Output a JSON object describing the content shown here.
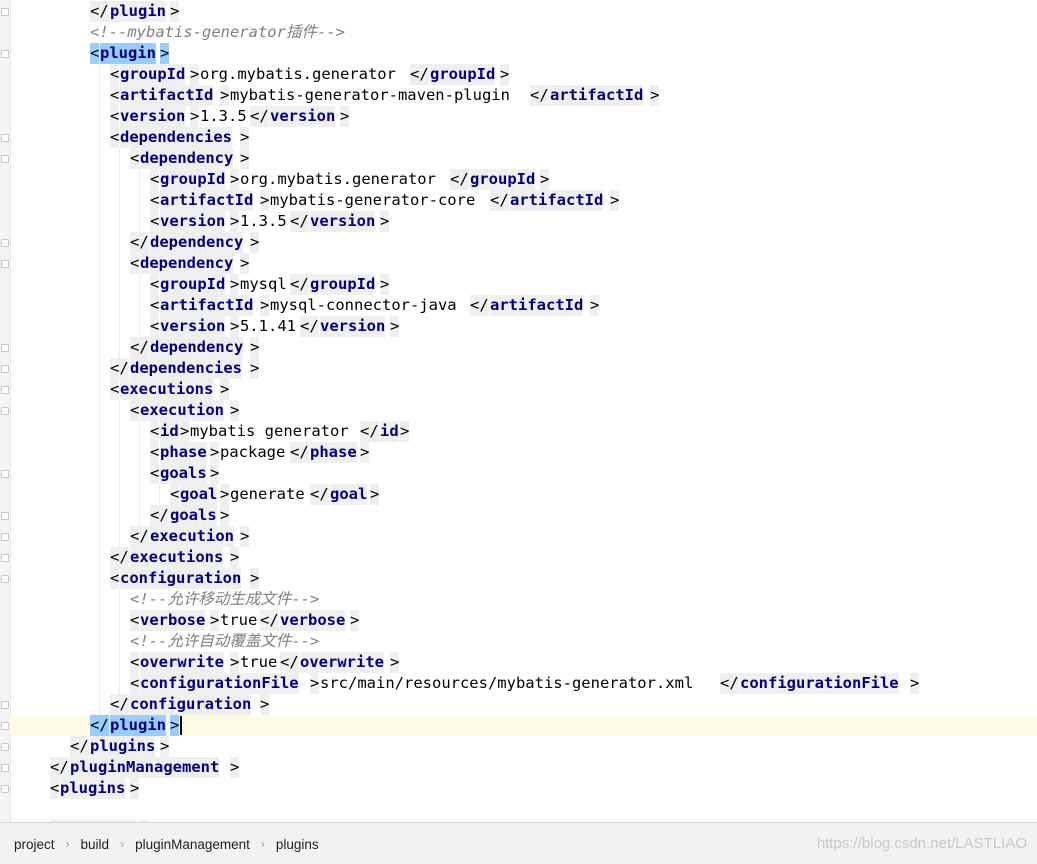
{
  "editor": {
    "lines": [
      {
        "t": [
          [
            "c",
            "</"
          ],
          [
            "n",
            "plugin"
          ],
          [
            "c",
            ">"
          ]
        ]
      },
      {
        "t": [
          [
            "m",
            "<!--mybatis-generator插件-->"
          ]
        ]
      },
      {
        "t": [
          [
            "o",
            "<"
          ],
          [
            "on",
            "plugin"
          ],
          [
            "o",
            ">"
          ]
        ]
      },
      {
        "t": [
          [
            "c",
            "<"
          ],
          [
            "n",
            "groupId"
          ],
          [
            "c",
            ">"
          ],
          [
            "x",
            "org.mybatis.generator"
          ],
          [
            "c",
            "</"
          ],
          [
            "n",
            "groupId"
          ],
          [
            "c",
            ">"
          ]
        ]
      },
      {
        "t": [
          [
            "c",
            "<"
          ],
          [
            "n",
            "artifactId"
          ],
          [
            "c",
            ">"
          ],
          [
            "x",
            "mybatis-generator-maven-plugin"
          ],
          [
            "c",
            "</"
          ],
          [
            "n",
            "artifactId"
          ],
          [
            "c",
            ">"
          ]
        ]
      },
      {
        "t": [
          [
            "c",
            "<"
          ],
          [
            "n",
            "version"
          ],
          [
            "c",
            ">"
          ],
          [
            "x",
            "1.3.5"
          ],
          [
            "c",
            "</"
          ],
          [
            "n",
            "version"
          ],
          [
            "c",
            ">"
          ]
        ]
      },
      {
        "t": [
          [
            "c",
            "<"
          ],
          [
            "n",
            "dependencies"
          ],
          [
            "c",
            ">"
          ]
        ]
      },
      {
        "t": [
          [
            "c",
            "<"
          ],
          [
            "n",
            "dependency"
          ],
          [
            "c",
            ">"
          ]
        ]
      },
      {
        "t": [
          [
            "c",
            "<"
          ],
          [
            "n",
            "groupId"
          ],
          [
            "c",
            ">"
          ],
          [
            "x",
            "org.mybatis.generator"
          ],
          [
            "c",
            "</"
          ],
          [
            "n",
            "groupId"
          ],
          [
            "c",
            ">"
          ]
        ]
      },
      {
        "t": [
          [
            "c",
            "<"
          ],
          [
            "n",
            "artifactId"
          ],
          [
            "c",
            ">"
          ],
          [
            "x",
            "mybatis-generator-core"
          ],
          [
            "c",
            "</"
          ],
          [
            "n",
            "artifactId"
          ],
          [
            "c",
            ">"
          ]
        ]
      },
      {
        "t": [
          [
            "c",
            "<"
          ],
          [
            "n",
            "version"
          ],
          [
            "c",
            ">"
          ],
          [
            "x",
            "1.3.5"
          ],
          [
            "c",
            "</"
          ],
          [
            "n",
            "version"
          ],
          [
            "c",
            ">"
          ]
        ]
      },
      {
        "t": [
          [
            "c",
            "</"
          ],
          [
            "n",
            "dependency"
          ],
          [
            "c",
            ">"
          ]
        ]
      },
      {
        "t": [
          [
            "c",
            "<"
          ],
          [
            "n",
            "dependency"
          ],
          [
            "c",
            ">"
          ]
        ]
      },
      {
        "t": [
          [
            "c",
            "<"
          ],
          [
            "n",
            "groupId"
          ],
          [
            "c",
            ">"
          ],
          [
            "x",
            "mysql"
          ],
          [
            "c",
            "</"
          ],
          [
            "n",
            "groupId"
          ],
          [
            "c",
            ">"
          ]
        ]
      },
      {
        "t": [
          [
            "c",
            "<"
          ],
          [
            "n",
            "artifactId"
          ],
          [
            "c",
            ">"
          ],
          [
            "x",
            "mysql-connector-java"
          ],
          [
            "c",
            "</"
          ],
          [
            "n",
            "artifactId"
          ],
          [
            "c",
            ">"
          ]
        ]
      },
      {
        "t": [
          [
            "c",
            "<"
          ],
          [
            "n",
            "version"
          ],
          [
            "c",
            ">"
          ],
          [
            "x",
            "5.1.41"
          ],
          [
            "c",
            "</"
          ],
          [
            "n",
            "version"
          ],
          [
            "c",
            ">"
          ]
        ]
      },
      {
        "t": [
          [
            "c",
            "</"
          ],
          [
            "n",
            "dependency"
          ],
          [
            "c",
            ">"
          ]
        ]
      },
      {
        "t": [
          [
            "c",
            "</"
          ],
          [
            "n",
            "dependencies"
          ],
          [
            "c",
            ">"
          ]
        ]
      },
      {
        "t": [
          [
            "c",
            "<"
          ],
          [
            "n",
            "executions"
          ],
          [
            "c",
            ">"
          ]
        ]
      },
      {
        "t": [
          [
            "c",
            "<"
          ],
          [
            "n",
            "execution"
          ],
          [
            "c",
            ">"
          ]
        ]
      },
      {
        "t": [
          [
            "c",
            "<"
          ],
          [
            "n",
            "id"
          ],
          [
            "c",
            ">"
          ],
          [
            "x",
            "mybatis generator"
          ],
          [
            "c",
            "</"
          ],
          [
            "n",
            "id"
          ],
          [
            "c",
            ">"
          ]
        ]
      },
      {
        "t": [
          [
            "c",
            "<"
          ],
          [
            "n",
            "phase"
          ],
          [
            "c",
            ">"
          ],
          [
            "x",
            "package"
          ],
          [
            "c",
            "</"
          ],
          [
            "n",
            "phase"
          ],
          [
            "c",
            ">"
          ]
        ]
      },
      {
        "t": [
          [
            "c",
            "<"
          ],
          [
            "n",
            "goals"
          ],
          [
            "c",
            ">"
          ]
        ]
      },
      {
        "t": [
          [
            "c",
            "<"
          ],
          [
            "n",
            "goal"
          ],
          [
            "c",
            ">"
          ],
          [
            "x",
            "generate"
          ],
          [
            "c",
            "</"
          ],
          [
            "n",
            "goal"
          ],
          [
            "c",
            ">"
          ]
        ]
      },
      {
        "t": [
          [
            "c",
            "</"
          ],
          [
            "n",
            "goals"
          ],
          [
            "c",
            ">"
          ]
        ]
      },
      {
        "t": [
          [
            "c",
            "</"
          ],
          [
            "n",
            "execution"
          ],
          [
            "c",
            ">"
          ]
        ]
      },
      {
        "t": [
          [
            "c",
            "</"
          ],
          [
            "n",
            "executions"
          ],
          [
            "c",
            ">"
          ]
        ]
      },
      {
        "t": [
          [
            "c",
            "<"
          ],
          [
            "n",
            "configuration"
          ],
          [
            "c",
            ">"
          ]
        ]
      },
      {
        "t": [
          [
            "m",
            "<!--允许移动生成文件-->"
          ]
        ]
      },
      {
        "t": [
          [
            "c",
            "<"
          ],
          [
            "n",
            "verbose"
          ],
          [
            "c",
            ">"
          ],
          [
            "x",
            "true"
          ],
          [
            "c",
            "</"
          ],
          [
            "n",
            "verbose"
          ],
          [
            "c",
            ">"
          ]
        ]
      },
      {
        "t": [
          [
            "m",
            "<!--允许自动覆盖文件-->"
          ]
        ]
      },
      {
        "t": [
          [
            "c",
            "<"
          ],
          [
            "n",
            "overwrite"
          ],
          [
            "c",
            ">"
          ],
          [
            "x",
            "true"
          ],
          [
            "c",
            "</"
          ],
          [
            "n",
            "overwrite"
          ],
          [
            "c",
            ">"
          ]
        ]
      },
      {
        "t": [
          [
            "c",
            "<"
          ],
          [
            "n",
            "configurationFile"
          ],
          [
            "c",
            ">"
          ],
          [
            "x",
            "src/main/resources/mybatis-generator.xml"
          ],
          [
            "c",
            "</"
          ],
          [
            "n",
            "configurationFile"
          ],
          [
            "c",
            ">"
          ]
        ]
      },
      {
        "t": [
          [
            "c",
            "</"
          ],
          [
            "n",
            "configuration"
          ],
          [
            "c",
            ">"
          ]
        ]
      },
      {
        "t": [
          [
            "o",
            "</"
          ],
          [
            "on",
            "plugin"
          ],
          [
            "o",
            ">"
          ]
        ]
      },
      {
        "t": [
          [
            "c",
            "</"
          ],
          [
            "n",
            "plugins"
          ],
          [
            "c",
            ">"
          ]
        ]
      },
      {
        "t": [
          [
            "c",
            "</"
          ],
          [
            "n",
            "pluginManagement"
          ],
          [
            "c",
            ">"
          ]
        ]
      },
      {
        "t": [
          [
            "c",
            "<"
          ],
          [
            "n",
            "plugins"
          ],
          [
            "c",
            ">"
          ]
        ]
      },
      {
        "t": []
      },
      {
        "t": [
          [
            "c",
            "</"
          ],
          [
            "n",
            "plugins"
          ],
          [
            "c",
            ">"
          ]
        ]
      }
    ]
  },
  "breadcrumb": {
    "items": [
      "project",
      "build",
      "pluginManagement",
      "plugins"
    ],
    "separator": "›"
  },
  "watermark": "https://blog.csdn.net/LASTLIAO"
}
